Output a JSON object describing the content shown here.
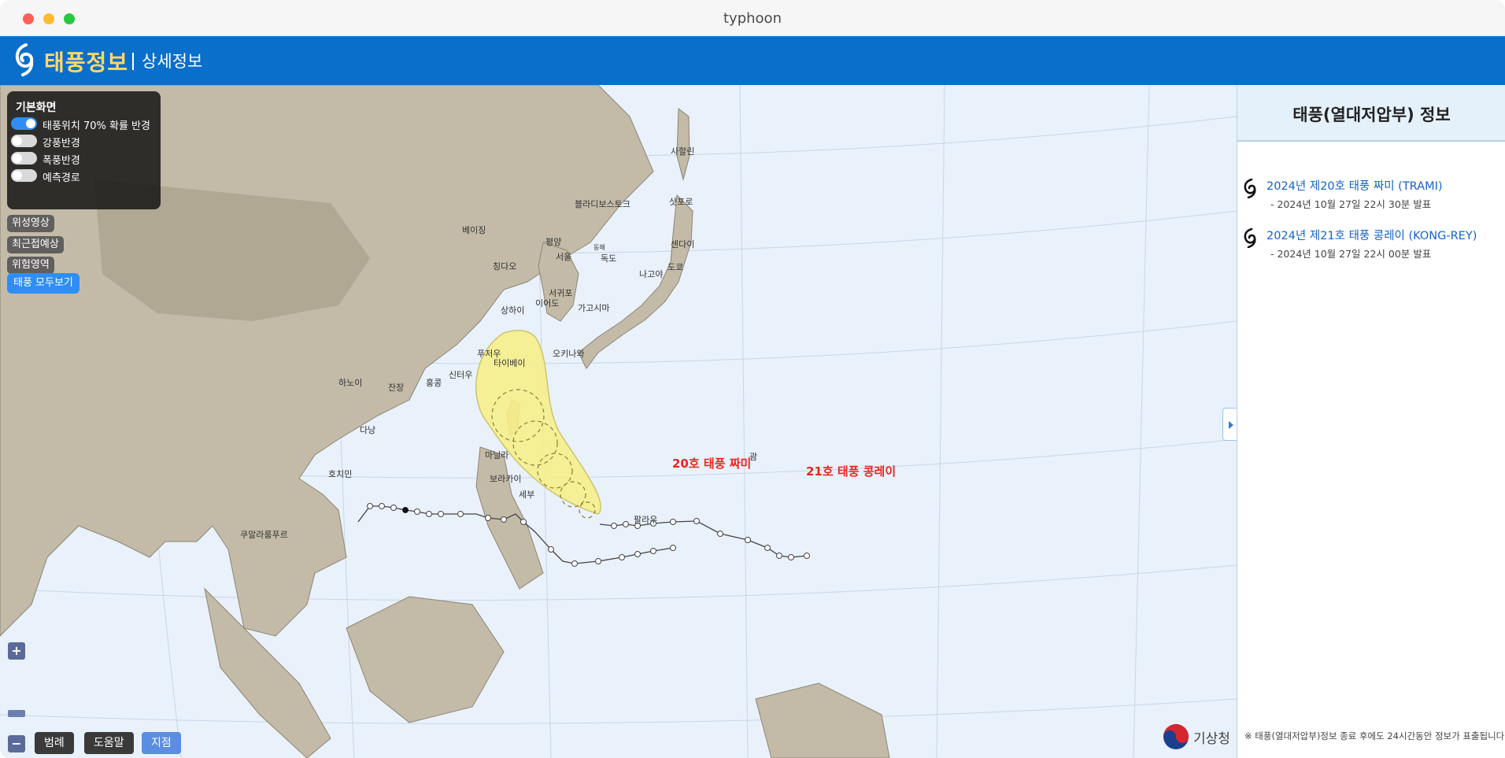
{
  "window": {
    "title": "typhoon"
  },
  "header": {
    "brand": "태풍정보",
    "subtitle": "상세정보"
  },
  "layers": {
    "title": "기본화면",
    "items": [
      {
        "label": "태풍위치 70% 확률 반경",
        "on": true
      },
      {
        "label": "강풍반경",
        "on": false
      },
      {
        "label": "폭풍반경",
        "on": false
      },
      {
        "label": "예측경로",
        "on": false
      }
    ]
  },
  "map_buttons": {
    "satellite": "위성영상",
    "closest": "최근접예상",
    "danger": "위험영역",
    "show_all": "태풍 모두보기"
  },
  "zoom": {
    "in": "+",
    "out": "−"
  },
  "bottom_buttons": {
    "legend": "범례",
    "help": "도움말",
    "point": "지점"
  },
  "places": [
    "사할린",
    "블라디보스토크",
    "삿포로",
    "베이징",
    "평양",
    "센다이",
    "서울",
    "동해",
    "독도",
    "칭다오",
    "도쿄",
    "나고야",
    "서귀포",
    "이어도",
    "가고시마",
    "상하이",
    "오키나와",
    "푸저우",
    "타이베이",
    "신터우",
    "하노이",
    "잔장",
    "홍콩",
    "다낭",
    "마닐라",
    "괌",
    "호치민",
    "보라카이",
    "세부",
    "팔라우",
    "쿠알라룸푸르"
  ],
  "storm_labels": {
    "trami": "20호 태풍 짜미",
    "kongrey": "21호 태풍 콩레이"
  },
  "brand_logo_text": "기상청",
  "panel": {
    "title": "태풍(열대저압부) 정보",
    "storms": [
      {
        "name": "2024년 제20호 태풍 짜미 (TRAMI)",
        "issued": "- 2024년 10월 27일 22시 30분 발표"
      },
      {
        "name": "2024년 제21호 태풍 콩레이 (KONG-REY)",
        "issued": "- 2024년 10월 27일 22시 00분 발표"
      }
    ],
    "note": "※ 태풍(열대저압부)정보 종료 후에도 24시간동안 정보가 표출됩니다."
  },
  "colors": {
    "header_blue": "#0a6fcb",
    "brand_yellow": "#ffd86b",
    "probability_cone": "#f7ef8a",
    "storm_label_red": "#e8261d",
    "link_blue": "#1464c8"
  }
}
